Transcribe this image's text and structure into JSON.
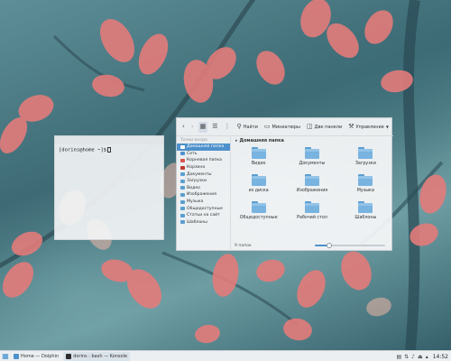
{
  "terminal": {
    "prompt": "[dorins@home ~]$"
  },
  "file_manager": {
    "toolbar": {
      "find_label": "Найти",
      "thumbnails_label": "Миниатюры",
      "split_label": "Две панели",
      "manage_label": "Управление"
    },
    "sidebar": {
      "header": "Точки входа",
      "items": [
        {
          "label": "Домашняя папка",
          "color": "#4e91cc",
          "selected": true
        },
        {
          "label": "Сеть",
          "color": "#4e91cc"
        },
        {
          "label": "Корневая папка",
          "color": "#d9534f"
        },
        {
          "label": "Корзина",
          "color": "#c0392b"
        },
        {
          "label": "Документы",
          "color": "#5b9fd1"
        },
        {
          "label": "Загрузки",
          "color": "#5b9fd1"
        },
        {
          "label": "Видео",
          "color": "#5b9fd1"
        },
        {
          "label": "Изображения",
          "color": "#5b9fd1"
        },
        {
          "label": "Музыка",
          "color": "#5b9fd1"
        },
        {
          "label": "Общедоступные",
          "color": "#5b9fd1"
        },
        {
          "label": "Статьи на сайт",
          "color": "#5b9fd1"
        },
        {
          "label": "Шаблоны",
          "color": "#5b9fd1"
        }
      ]
    },
    "breadcrumb": "Домашняя папка",
    "folders": [
      {
        "label": "Видео"
      },
      {
        "label": "Документы"
      },
      {
        "label": "Загрузки"
      },
      {
        "label": "из диска"
      },
      {
        "label": "Изображения"
      },
      {
        "label": "Музыка"
      },
      {
        "label": "Общедоступные"
      },
      {
        "label": "Рабочий стол"
      },
      {
        "label": "Шаблоны"
      }
    ],
    "status": "9 папок",
    "zoom_level": 0.2
  },
  "taskbar": {
    "tasks": [
      {
        "label": "Home — Dolphin",
        "active": false,
        "color": "#4e91cc"
      },
      {
        "label": "dorins : bash — Konsole",
        "active": true,
        "color": "#2d2d2d"
      }
    ],
    "clock": "14:52"
  }
}
